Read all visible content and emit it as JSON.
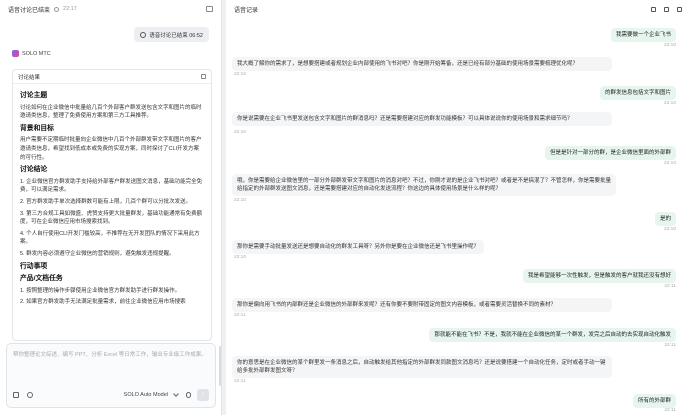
{
  "left": {
    "title": "语音讨论已结束",
    "time": "22:17",
    "pill_text": "语音讨论已结束 06:52",
    "brand": "SOLO MTC",
    "card_title": "讨论结果",
    "sections": [
      {
        "h": "讨论主题",
        "p": "讨论如何在企业微信中批量给几百个外部客户群发送包含文字和图片的临时邀请类信息，整理了免费使用方案和第三方工具推荐。"
      },
      {
        "h": "背景和目标",
        "p": "用户需要不定期临时批量向企业微信中几百个外部群发带文字和图片的客户邀请类信息，希望找到低成本或免费的实现方案，同时探讨了CLI开发方案的可行性。"
      }
    ],
    "conclusion_h": "讨论结论",
    "conclusions": [
      "1. 企业微信官方群发助手支持给外部客户群发送图文消息，基础功能完全免费，可以满足需求。",
      "2. 官方群发助手单次选择群数可能有上限，几百个群可以分批次发送。",
      "3. 第三方合规工具如微盛、虎赞支持更大批量群发，基础功能通常有免费额度，可在企业微信应用市场搜索找到。",
      "4. 个人自行使用CLI开发门槛较高，不推荐在无开发团队的情况下采用此方案。",
      "5. 群发内容必须遵守企业微信的营销规则，避免触发违规提醒。"
    ],
    "todo_h": "行动事项",
    "docs_h": "产品/文档任务",
    "docs": [
      "1. 按照整理的操作步骤使用企业微信官方群发助手进行群发操作。",
      "2. 如果官方群发助手无法满足批量需求，前往企业微信应用市场搜索"
    ],
    "composer_placeholder": "帮你整理论文综述、编写 PPT、分析 Excel 等日常工作，输出专业级工作成果。",
    "model": "SOLO Auto Model",
    "send": "↑"
  },
  "right": {
    "title": "语音记录",
    "messages": [
      {
        "role": "user",
        "text": "我需要做一个企业飞书",
        "time": "22:10"
      },
      {
        "role": "ai",
        "text": "我大概了解你的需求了，是想要搭建或者规划企业内部使用的飞书对吧？你是刚开始筹备，还是已经有部分基础的使用场景需要梳理优化呢？",
        "time": "22:10"
      },
      {
        "role": "user",
        "text": "的群发信息包括文字和图片",
        "time": "22:10"
      },
      {
        "role": "ai",
        "text": "你是说需要在企业飞书里发送包含文字和图片的群消息吗？还是需要搭建对应的群发功能模板？可以具体说说你的使用场景和需求细节吗？",
        "time": "22:10"
      },
      {
        "role": "user",
        "text": "但是是针对一部分的群，是企业微信里面的外部群",
        "time": "22:10"
      },
      {
        "role": "ai",
        "text": "哦，你是需要给企业微信里的一部分外部群发带文字和图片的消息对吧？不过，你刚才说的是企业飞书对吧？或者是不是搞混了？不管怎样，你是需要批量给指定的外部群发送图文消息，还是需要搭建对应的自动化发送流程？你这边的具体使用场景是什么样的呢？",
        "time": "22:10"
      },
      {
        "role": "user",
        "text": "是的",
        "time": "22:10"
      },
      {
        "role": "ai",
        "text": "那你是需要手动批量发送还是想要自动化的群发工具呀？另外你是要在企业微信还是飞书里操作呢？",
        "time": "22:10"
      },
      {
        "role": "user",
        "text": "我是希望能够一次性触发，但是触发的客户就我还没有想好",
        "time": "22:11"
      },
      {
        "role": "ai",
        "text": "那你是偏向用飞书的内部群还是企业微信的外部群来发呢？还有你要不要附带固定的图文内容模板，或者需要灵活替换不同的素材？",
        "time": "22:11"
      },
      {
        "role": "user",
        "text": "那就能不能在飞书？不是，我就不能在企业微信的某一个群发，发完之后自动的去实现自动化触发",
        "time": "22:11"
      },
      {
        "role": "ai",
        "text": "你的意思是在企业微信的某个群里发一条消息之后，自动触发给其他指定的外部群发同款图文消息吗？还是说要搭建一个自动化任务，定时或者手动一键给多批外部群发图文呀？",
        "time": "22:11"
      },
      {
        "role": "user",
        "text": "所有的外部群",
        "time": "22:11"
      }
    ]
  }
}
